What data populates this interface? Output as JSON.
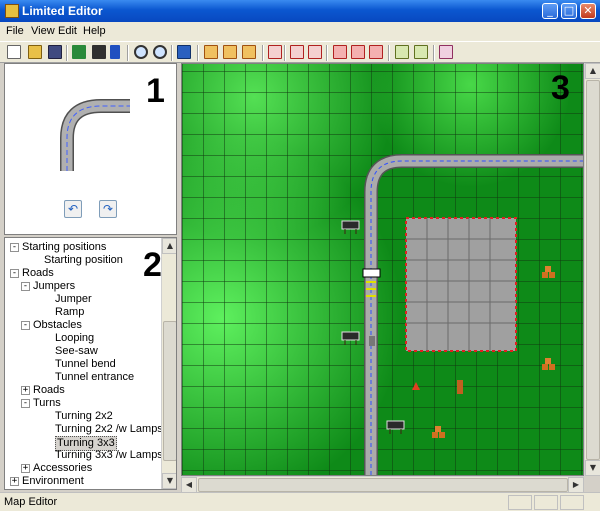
{
  "window": {
    "title": "Limited Editor"
  },
  "menu": [
    "File",
    "View",
    "Edit",
    "Help"
  ],
  "panels": {
    "preview_number": "1",
    "tree_number": "2",
    "map_number": "3"
  },
  "tree": [
    {
      "label": "Starting positions",
      "level": 0,
      "toggle": "-"
    },
    {
      "label": "Starting position",
      "level": 1,
      "toggle": ""
    },
    {
      "label": "Roads",
      "level": 0,
      "toggle": "-"
    },
    {
      "label": "Jumpers",
      "level": 1,
      "toggle": "-"
    },
    {
      "label": "Jumper",
      "level": 2,
      "toggle": ""
    },
    {
      "label": "Ramp",
      "level": 2,
      "toggle": ""
    },
    {
      "label": "Obstacles",
      "level": 1,
      "toggle": "-"
    },
    {
      "label": "Looping",
      "level": 2,
      "toggle": ""
    },
    {
      "label": "See-saw",
      "level": 2,
      "toggle": ""
    },
    {
      "label": "Tunnel bend",
      "level": 2,
      "toggle": ""
    },
    {
      "label": "Tunnel entrance",
      "level": 2,
      "toggle": ""
    },
    {
      "label": "Roads",
      "level": 1,
      "toggle": "+"
    },
    {
      "label": "Turns",
      "level": 1,
      "toggle": "-"
    },
    {
      "label": "Turning 2x2",
      "level": 2,
      "toggle": ""
    },
    {
      "label": "Turning 2x2 /w Lamps",
      "level": 2,
      "toggle": ""
    },
    {
      "label": "Turning 3x3",
      "level": 2,
      "toggle": "",
      "selected": true
    },
    {
      "label": "Turning 3x3 /w Lamps",
      "level": 2,
      "toggle": ""
    },
    {
      "label": "Accessories",
      "level": 1,
      "toggle": "+"
    },
    {
      "label": "Environment",
      "level": 0,
      "toggle": "+"
    }
  ],
  "status": {
    "text": "Map Editor"
  },
  "colors": {
    "grass": "#22c02e",
    "road": "#9a9a9a",
    "lane": "#3050ff",
    "title_bar": "#0b57d0",
    "pad": "#a0a0a0"
  }
}
